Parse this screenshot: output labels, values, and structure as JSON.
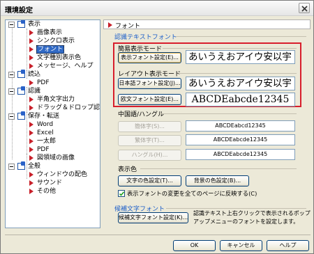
{
  "window": {
    "title": "環境設定"
  },
  "tree": {
    "categories": {
      "display": "表示",
      "read": "読込",
      "recognition": "認識",
      "save": "保存・転送",
      "general": "全般"
    },
    "items": {
      "image_display": "画像表示",
      "sync_display": "シンクロ表示",
      "font": "フォント",
      "char_color": "文字種別表示色",
      "message_help": "メッセージ、ヘルプ",
      "read_pdf": "PDF",
      "halfwidth": "半角文字出力",
      "drag_drop": "ドラッグ＆ドロップ認識",
      "word": "Word",
      "excel": "Excel",
      "ichitaro": "一太郎",
      "save_pdf": "PDF",
      "region_image": "図領域の画像",
      "window_color": "ウィンドウの配色",
      "sound": "サウンド",
      "other": "その他"
    }
  },
  "panel": {
    "header": "フォント",
    "recognized_font": {
      "label": "認識テキストフォント",
      "simple_mode_label": "簡易表示モード",
      "display_font_btn": "表示フォント設定(E)...",
      "display_preview": "あいうえおアイウ安以宇",
      "layout_mode_label": "レイアウト表示モード",
      "jp_font_btn": "日本語フォント設定(J)...",
      "jp_preview": "あいうえおアイウ安以宇",
      "en_font_btn": "欧文フォント設定(E)...",
      "en_preview": "ABCDEabcde12345",
      "chinese_label": "中国語/ハングル",
      "simplified_btn": "簡体字(S)...",
      "simplified_preview": "ABCDEabcd12345",
      "traditional_btn": "繁体字(T)...",
      "traditional_preview": "ABCDEabcde12345",
      "hangul_btn": "ハングル(H)...",
      "hangul_preview": "ABCDEabcde12345"
    },
    "display_color": {
      "label": "表示色",
      "text_color_btn": "文字の色設定(T)...",
      "bg_color_btn": "背景の色設定(B)...",
      "apply_all_checkbox": "表示フォントの変更を全てのページに反映する(C)",
      "apply_all_checked": true
    },
    "candidate_font": {
      "label": "候補文字フォント",
      "btn": "候補文字フォント設定(K)...",
      "desc_line1": "認識テキスト上右クリックで表示されるポップ",
      "desc_line2": "アップメニューのフォントを設定します。"
    }
  },
  "footer": {
    "ok": "OK",
    "cancel": "キャンセル",
    "help": "ヘルプ"
  },
  "colors": {
    "accent_red": "#d81e2c",
    "group_blue": "#1c5ec9",
    "select_blue": "#316ac5"
  }
}
